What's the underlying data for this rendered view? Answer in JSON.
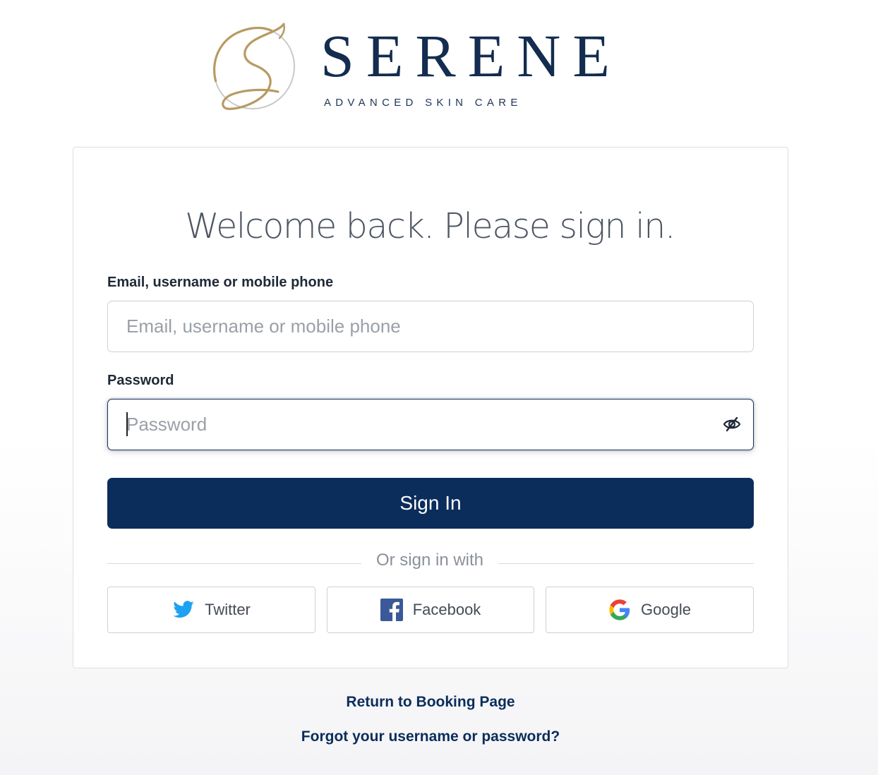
{
  "brand": {
    "name": "SERENE",
    "tagline": "ADVANCED SKIN CARE",
    "colors": {
      "navy": "#132c4f",
      "gold": "#b89a63"
    }
  },
  "login": {
    "title": "Welcome back. Please sign in.",
    "email_label": "Email, username or mobile phone",
    "email_placeholder": "Email, username or mobile phone",
    "email_value": "",
    "password_label": "Password",
    "password_placeholder": "Password",
    "password_value": "",
    "password_toggle_icon": "eye-slash-icon",
    "signin_label": "Sign In",
    "signin_color": "#0b2d5b",
    "divider_text": "Or sign in with"
  },
  "social": {
    "twitter_label": "Twitter",
    "twitter_icon": "twitter-bird-icon",
    "facebook_label": "Facebook",
    "facebook_icon": "facebook-icon",
    "google_label": "Google",
    "google_icon": "google-g-icon"
  },
  "footer": {
    "booking_link": "Return to Booking Page",
    "forgot_link": "Forgot your username or password?"
  }
}
